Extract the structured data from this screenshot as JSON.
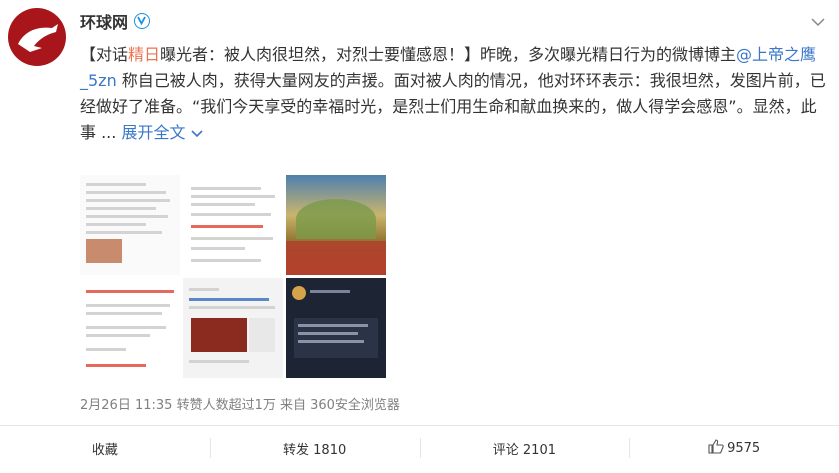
{
  "post": {
    "author": "环球网",
    "text_prefix": "【对话",
    "text_highlight": "精日",
    "text_after_highlight": "曝光者：被人肉很坦然，对烈士要懂感恩！】昨晚，多次曝光精日行为的微博博主",
    "mention": "@上帝之鹰_5zn",
    "text_body": " 称自己被人肉，获得大量网友的声援。面对被人肉的情况，他对环环表示：我很坦然，发图片前，已经做好了准备。“我们今天享受的幸福时光，是烈士们用生命和献血换来的，做人得学会感恩”。显然，此事  ...",
    "expand_label": "展开全文",
    "date": "2月26日 11:35",
    "source_text": "转赞人数超过1万 来自 360安全浏览器"
  },
  "actions": {
    "favorite": "收藏",
    "repost": "转发 1810",
    "comment": "评论 2101",
    "like_count": "9575"
  },
  "icons": {
    "verified": "verified-icon",
    "chevron": "chevron-down-icon",
    "expand": "expand-chevron-icon",
    "like": "thumbs-up-icon"
  },
  "colors": {
    "highlight": "#eb7350",
    "link": "#3a77c9",
    "brand_red": "#a8161b",
    "verified_blue": "#1b8fe0"
  }
}
